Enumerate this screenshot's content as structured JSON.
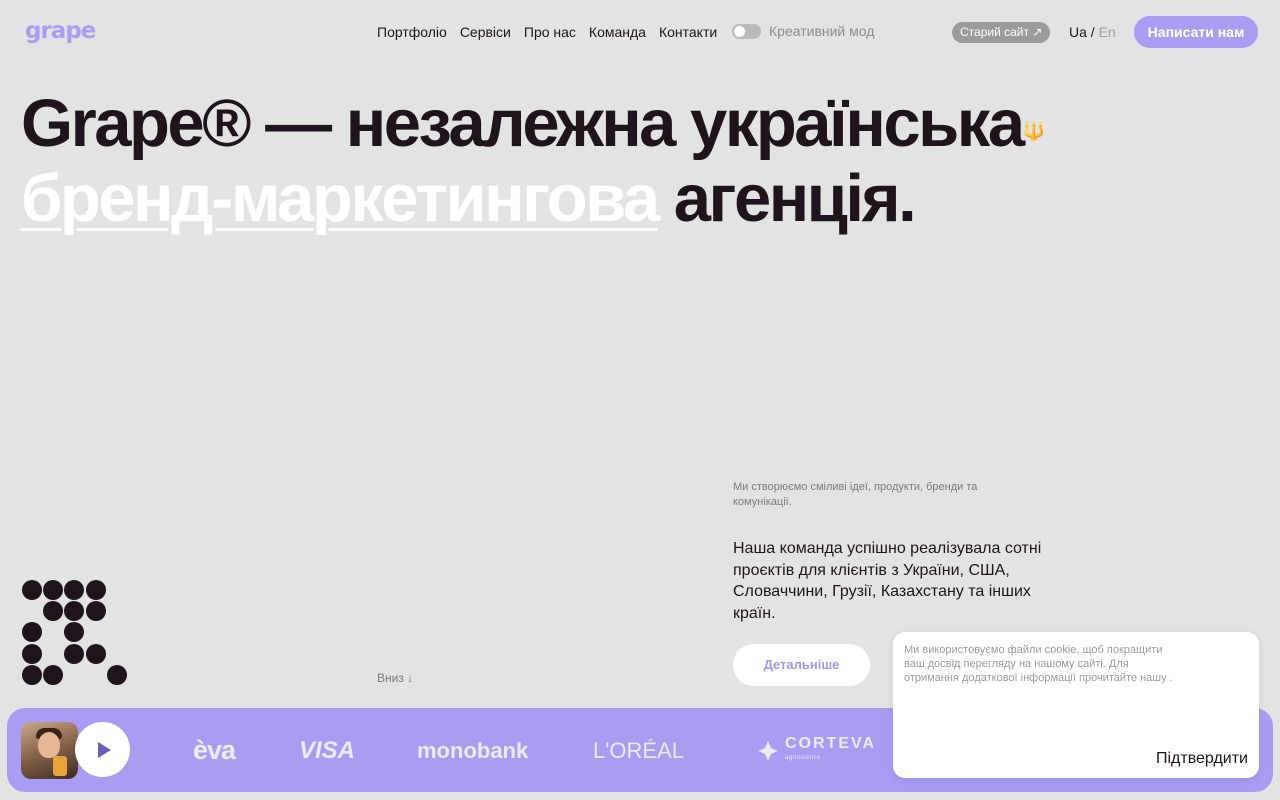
{
  "header": {
    "logo": "grape",
    "nav": [
      "Портфоліо",
      "Сервіси",
      "Про нас",
      "Команда",
      "Контакти"
    ],
    "creative_mode_label": "Креативний мод",
    "old_site_label": "Старий сайт ↗",
    "lang_ua": "Ua",
    "lang_sep": " / ",
    "lang_en": "En",
    "cta_label": "Написати нам"
  },
  "hero": {
    "line1": "Grape® — незалежна українська",
    "trident": "🔱",
    "line2_accent": "бренд-маркетингова",
    "line2_rest": " агенція."
  },
  "intro": {
    "small": "Ми створюємо сміливі ідеї, продукти, бренди та комунікації.",
    "big": "Наша команда успішно реалізувала сотні проєктів для клієнтів з України, США, Словаччини, Грузії, Казахстану та інших країн.",
    "more_label": "Детальніше",
    "scroll_label": "Вниз ↓"
  },
  "clients": {
    "brands": [
      "èva",
      "VISA",
      "monobank",
      "L'ORÉAL",
      "CORTEVA"
    ],
    "corteva_sub": "agriscience",
    "play_icon": "play-icon"
  },
  "cookie": {
    "text": "Ми використовуємо файли cookie, щоб покращити ваш досвід перегляду на нашому сайті. Для отримання додаткової інформації прочитайте нашу .",
    "confirm_label": "Підтвердити"
  },
  "colors": {
    "background": "#e3e3e3",
    "accent": "#a89df3",
    "text": "#1f141d",
    "white": "#ffffff"
  }
}
